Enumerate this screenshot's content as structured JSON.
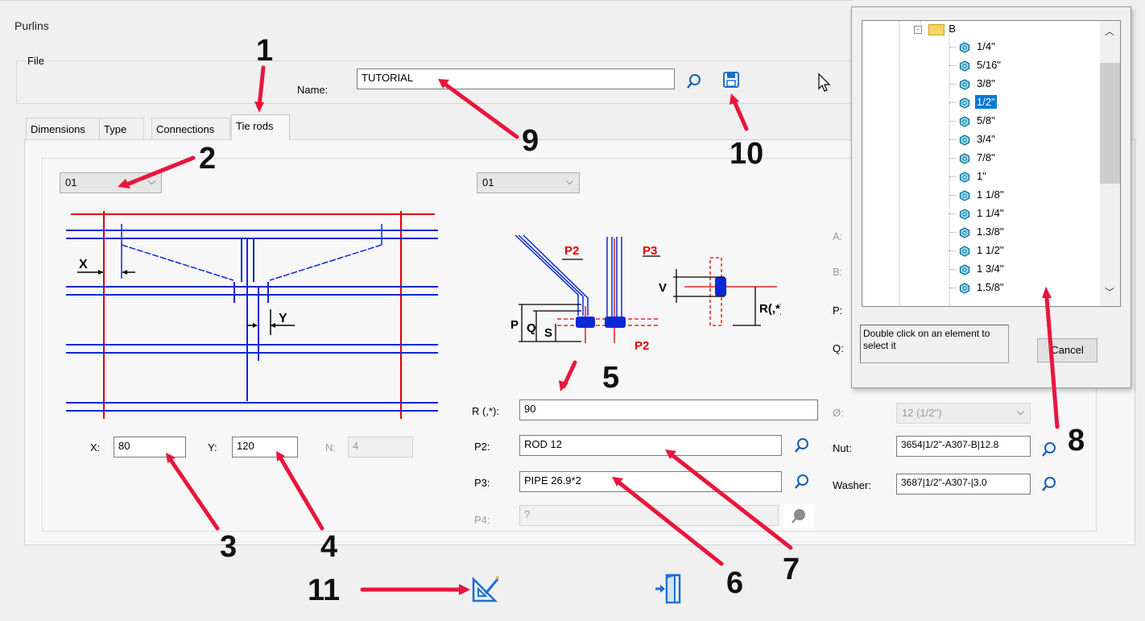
{
  "window": {
    "title": "Purlins",
    "menu_file": "File"
  },
  "header": {
    "name_label": "Name:",
    "name_value": "TUTORIAL"
  },
  "tabs": [
    {
      "label": "Dimensions"
    },
    {
      "label": "Type"
    },
    {
      "label": "Connections"
    },
    {
      "label": "Tie rods"
    }
  ],
  "left": {
    "combo_value": "01",
    "diagram_labels": {
      "x": "X",
      "y": "Y"
    },
    "x_label": "X:",
    "x_value": "80",
    "y_label": "Y:",
    "y_value": "120",
    "n_label": "N:",
    "n_value": "4"
  },
  "right": {
    "combo_value": "01",
    "diagram_labels": {
      "p2a": "P2",
      "p3": "P3",
      "p2b": "P2",
      "p": "P",
      "q": "Q",
      "s": "S",
      "v": "V",
      "r": "R(,*)"
    },
    "r_label": "R (,*):",
    "r_value": "90",
    "p2_label": "P2:",
    "p2_value": "ROD 12",
    "p3_label": "P3:",
    "p3_value": "PIPE 26.9*2",
    "p4_label": "P4:",
    "p4_value": "?"
  },
  "far_right": {
    "a_label": "A:",
    "b_label": "B:",
    "p_label": "P:",
    "q_label": "Q:",
    "dia_label": "Ø:",
    "dia_value": "12 (1/2\")",
    "nut_label": "Nut:",
    "nut_value": "3654|1/2\"-A307-B|12.8",
    "washer_label": "Washer:",
    "washer_value": "3687|1/2\"-A307-|3.0"
  },
  "popup": {
    "folder": "B",
    "items": [
      "1/4\"",
      "5/16\"",
      "3/8\"",
      "1/2\"",
      "5/8\"",
      "3/4\"",
      "7/8\"",
      "1\"",
      "1 1/8\"",
      "1 1/4\"",
      "1.3/8\"",
      "1 1/2\"",
      "1 3/4\"",
      "1.5/8\""
    ],
    "selected": "1/2\"",
    "hint": "Double click on an element to select it",
    "cancel": "Cancel"
  },
  "annotations": [
    "1",
    "2",
    "3",
    "4",
    "5",
    "6",
    "7",
    "8",
    "9",
    "10",
    "11"
  ],
  "colors": {
    "annotation_arrow": "#e8163c",
    "accent": "#0078d7",
    "diagram_red": "#e00000",
    "diagram_blue": "#0a28d8"
  }
}
